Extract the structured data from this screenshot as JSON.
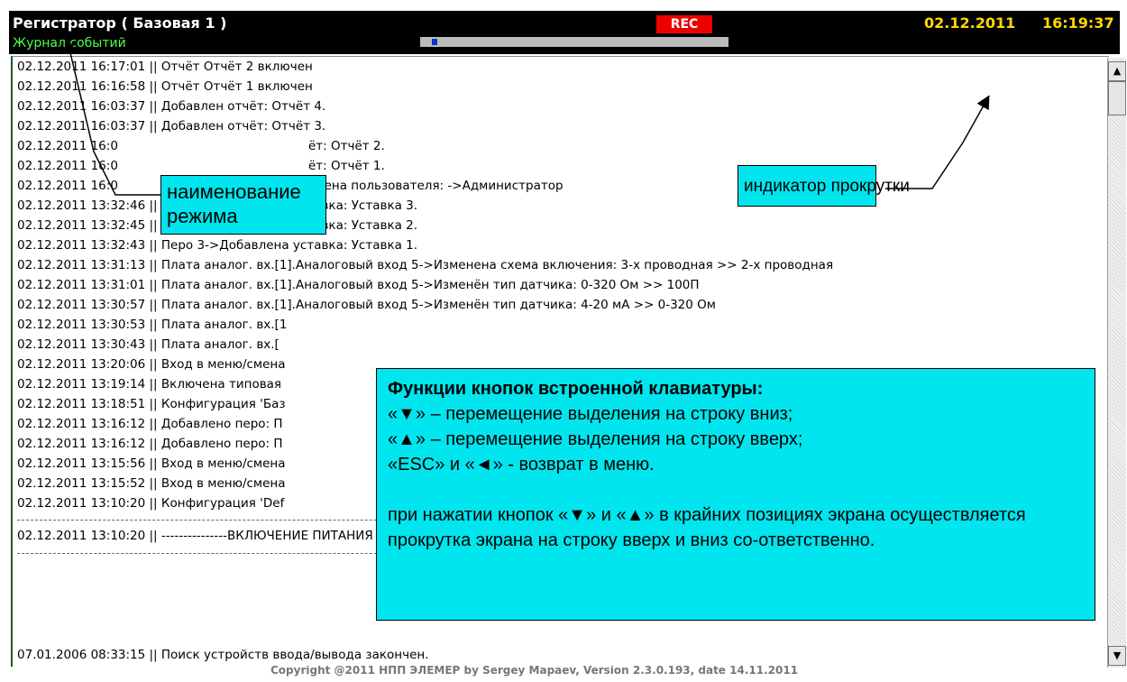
{
  "header": {
    "title": "Регистратор ( Базовая 1 )",
    "mode": "Журнал событий",
    "rec": "REC",
    "date": "02.12.2011",
    "time": "16:19:37",
    "progress_fraction": 0.02
  },
  "log": {
    "lines": [
      "02.12.2011  16:17:01 || Отчёт Отчёт 2 включен",
      "02.12.2011  16:16:58 || Отчёт Отчёт 1 включен",
      "02.12.2011  16:03:37 || Добавлен отчёт: Отчёт 4.",
      "02.12.2011  16:03:37 || Добавлен отчёт: Отчёт 3.",
      "02.12.2011  16:0",
      "02.12.2011  16:0",
      "02.12.2011  16:0",
      "02.12.2011  13:32:46 || Перо 3->Добавлена уставка: Уставка 3.",
      "02.12.2011  13:32:45 || Перо 3->Добавлена уставка: Уставка 2.",
      "02.12.2011  13:32:43 || Перо 3->Добавлена уставка: Уставка 1.",
      "02.12.2011  13:31:13 || Плата аналог. вх.[1].Аналоговый вход 5->Изменена схема включения: 3-х проводная >> 2-х проводная",
      "02.12.2011  13:31:01 || Плата аналог. вх.[1].Аналоговый вход 5->Изменён тип датчика: 0-320 Ом >> 100П",
      "02.12.2011  13:30:57 || Плата аналог. вх.[1].Аналоговый вход 5->Изменён тип датчика: 4-20 мА >> 0-320 Ом",
      "02.12.2011  13:30:53 || Плата аналог. вх.[1",
      "02.12.2011  13:30:43 || Плата аналог. вх.[",
      "02.12.2011  13:20:06 || Вход в меню/смена",
      "02.12.2011  13:19:14 || Включена типовая",
      "02.12.2011  13:18:51 || Конфигурация 'Баз",
      "02.12.2011  13:16:12 || Добавлено перо: П",
      "02.12.2011  13:16:12 || Добавлено перо: П",
      "02.12.2011  13:15:56 || Вход в меню/смена",
      "02.12.2011  13:15:52 || Вход в меню/смена",
      "02.12.2011  13:10:20 || Конфигурация 'Def",
      "02.12.2011  13:10:20 || ---------------ВКЛЮЧЕНИЕ ПИТАНИЯ ПРИБОРА----------------",
      "07.01.2006  08:33:15 || Поиск устройств ввода/вывода закончен."
    ],
    "partial_texts": [
      "ёт: Отчёт 2.",
      "ёт: Отчёт 1.",
      "смена пользователя: ->Администратор"
    ]
  },
  "footer": "Copyright @2011 НПП ЭЛЕМЕР by Sergey Mapaev, Version 2.3.0.193, date 14.11.2011",
  "callouts": {
    "mode_name": "наименование режима",
    "scroll_indicator": "индикатор прокрутки",
    "keys_title": "Функции кнопок встроенной клавиатуры:",
    "keys_lines": [
      "«▼» – перемещение выделения на строку вниз;",
      "«▲» – перемещение выделения на строку вверх;",
      "«ESC» и «◄» - возврат в меню."
    ],
    "keys_note": "при нажатии кнопок «▼» и «▲» в крайних позициях экрана осуществляется прокрутка экрана на строку вверх и вниз со-ответственно."
  },
  "scroll": {
    "up": "▲",
    "down": "▼"
  }
}
